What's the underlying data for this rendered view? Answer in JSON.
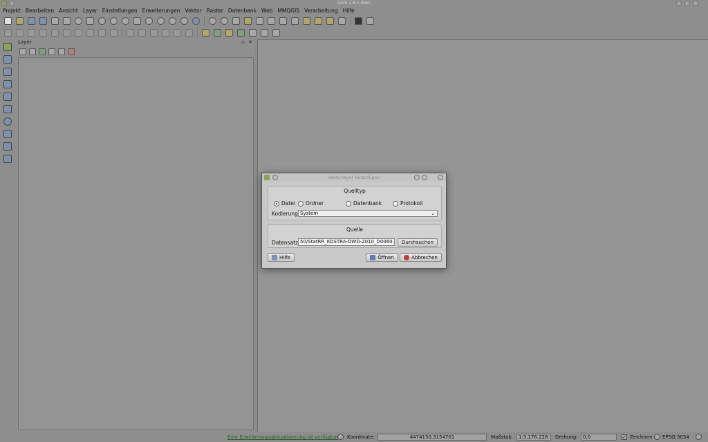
{
  "window": {
    "title": "QGIS 2.8.2-Wien"
  },
  "menubar": [
    "Projekt",
    "Bearbeiten",
    "Ansicht",
    "Layer",
    "Einstellungen",
    "Erweiterungen",
    "Vektor",
    "Raster",
    "Datenbank",
    "Web",
    "MMQGIS",
    "Verarbeitung",
    "Hilfe"
  ],
  "layer_panel": {
    "title": "Layer"
  },
  "dialog": {
    "title": "Vektorlayer hinzufügen",
    "source_type_title": "Quelltyp",
    "radios": [
      "Datei",
      "Ordner",
      "Datenbank",
      "Protokoll"
    ],
    "selected_radio": "Datei",
    "encoding_label": "Kodierung",
    "encoding_value": "System",
    "source_title": "Quelle",
    "dataset_label": "Datensatz",
    "dataset_value": "50/StatRR_KOSTRA-DWD-2010_D0060.shp",
    "browse_label": "Durchsuchen",
    "help_label": "Hilfe",
    "open_label": "Öffnen",
    "cancel_label": "Abbrechen"
  },
  "status": {
    "plugin_update_link": "Eine Erweiterungsaktualisierung ist verfügbar",
    "coordinate_label": "Koordinate:",
    "coordinate_value": "4474150,3154701",
    "scale_label": "Maßstab",
    "scale_value": "1:3.176.228",
    "rotation_label": "Drehung:",
    "rotation_value": "0,0",
    "render_label": "Zeichnen",
    "crs_label": "EPSG:3034"
  }
}
